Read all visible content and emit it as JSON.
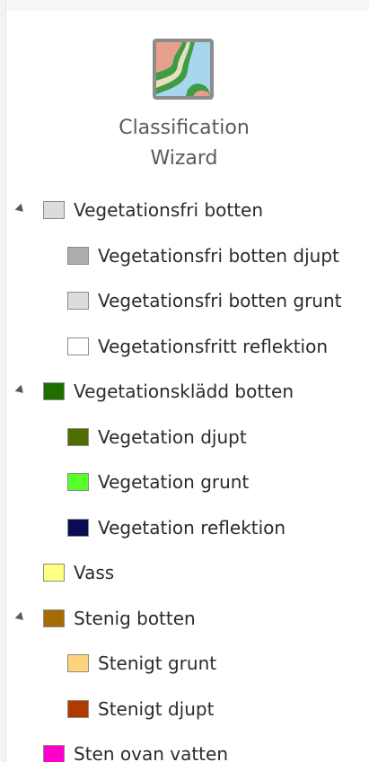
{
  "tool": {
    "label_line1": "Classification",
    "label_line2": "Wizard"
  },
  "classes": [
    {
      "label": "Vegetationsfri botten",
      "color": "#dcdcdc",
      "level": 0,
      "expandable": true
    },
    {
      "label": "Vegetationsfri botten djupt",
      "color": "#adadad",
      "level": 1,
      "expandable": false
    },
    {
      "label": "Vegetationsfri botten grunt",
      "color": "#dcdcdc",
      "level": 1,
      "expandable": false
    },
    {
      "label": "Vegetationsfritt reflektion",
      "color": "#ffffff",
      "level": 1,
      "expandable": false
    },
    {
      "label": "Vegetationsklädd botten",
      "color": "#1e6f00",
      "level": 0,
      "expandable": true
    },
    {
      "label": "Vegetation djupt",
      "color": "#4f6e00",
      "level": 1,
      "expandable": false
    },
    {
      "label": "Vegetation grunt",
      "color": "#59ff2b",
      "level": 1,
      "expandable": false
    },
    {
      "label": "Vegetation reflektion",
      "color": "#0b0b54",
      "level": 1,
      "expandable": false
    },
    {
      "label": "Vass",
      "color": "#ffff80",
      "level": 0,
      "expandable": false
    },
    {
      "label": "Stenig botten",
      "color": "#a76b05",
      "level": 0,
      "expandable": true
    },
    {
      "label": "Stenigt grunt",
      "color": "#ffd27d",
      "level": 1,
      "expandable": false
    },
    {
      "label": "Stenigt djupt",
      "color": "#b13a00",
      "level": 1,
      "expandable": false
    },
    {
      "label": "Sten ovan vatten",
      "color": "#ff00c8",
      "level": 0,
      "expandable": false
    }
  ]
}
